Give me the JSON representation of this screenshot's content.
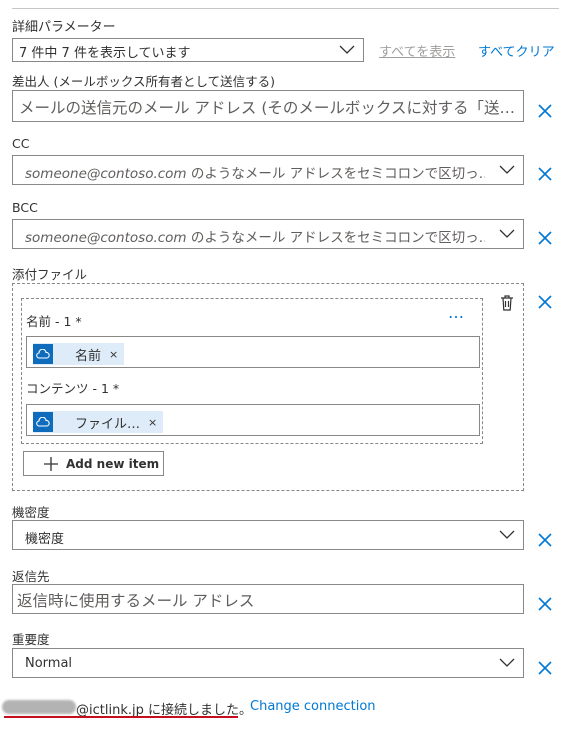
{
  "header": {
    "title": "詳細パラメーター"
  },
  "params_dropdown": {
    "value": "7 件中 7 件を表示しています"
  },
  "actions": {
    "show_all": "すべてを表示",
    "clear_all": "すべてクリア"
  },
  "from": {
    "label": "差出人 (メールボックス所有者として送信する)",
    "placeholder": "メールの送信元のメール アドレス (そのメールボックスに対する「送…"
  },
  "cc": {
    "label": "CC",
    "placeholder_email": "someone@contoso.com",
    "placeholder_rest": " のようなメール アドレスをセミコロンで区切っ…"
  },
  "bcc": {
    "label": "BCC",
    "placeholder_email": "someone@contoso.com",
    "placeholder_rest": " のようなメール アドレスをセミコロンで区切っ…"
  },
  "attachments": {
    "label": "添付ファイル",
    "more_label": "…",
    "name_label": "名前 - 1 *",
    "name_token": "名前",
    "content_label": "コンテンツ - 1 *",
    "content_token": "ファイル…",
    "token_remove": "×",
    "add_item": "Add new item"
  },
  "sensitivity": {
    "label": "機密度",
    "value": "機密度"
  },
  "reply_to": {
    "label": "返信先",
    "placeholder": "返信時に使用するメール アドレス"
  },
  "importance": {
    "label": "重要度",
    "value": "Normal"
  },
  "footer": {
    "connected_text": "@ictlink.jp に接続しました。",
    "change_connection": "Change connection"
  },
  "colors": {
    "accent": "#0078d4",
    "token_bg": "#deecf9",
    "underline": "#c50f1f",
    "border": "#8a8886"
  },
  "icons": [
    "chevron-down-icon",
    "close-icon",
    "cloud-icon",
    "delete-icon",
    "plus-icon",
    "more-icon"
  ]
}
